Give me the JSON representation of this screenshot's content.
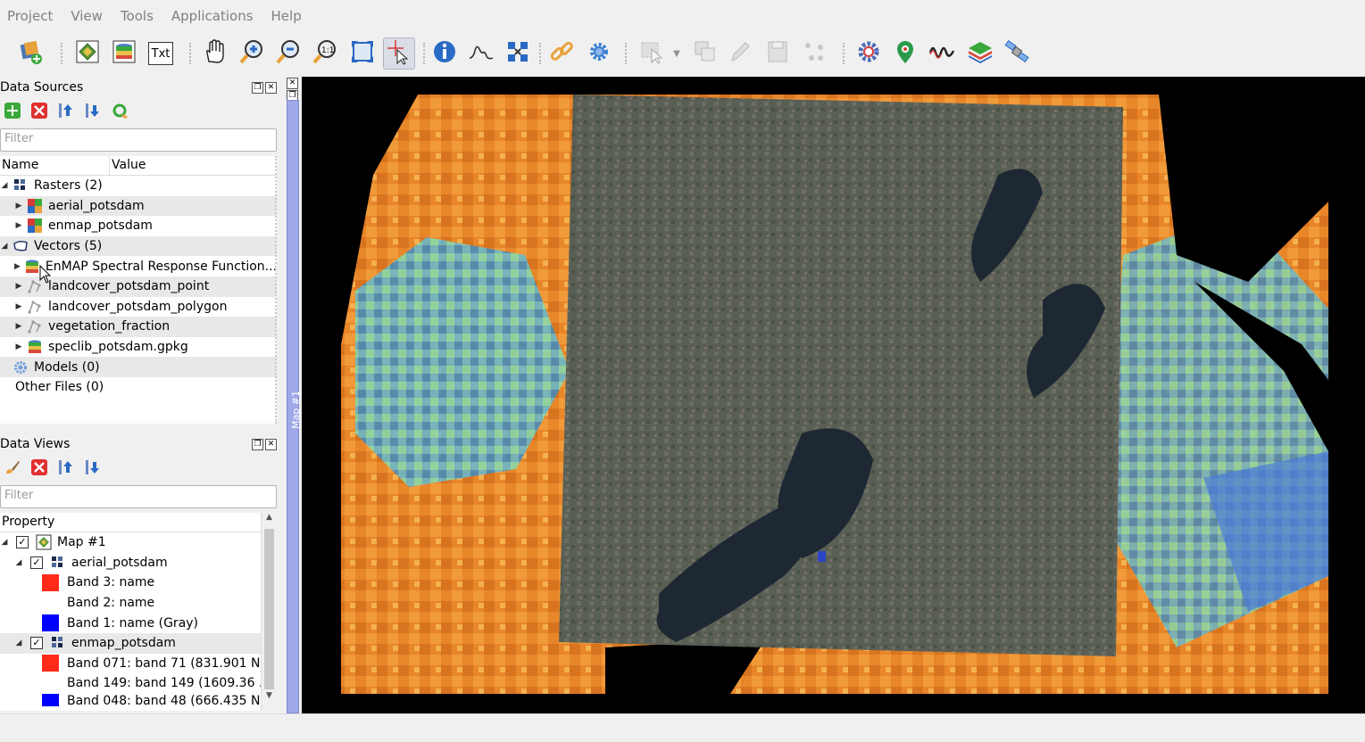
{
  "menu": [
    "Project",
    "View",
    "Tools",
    "Applications",
    "Help"
  ],
  "toolbar": {
    "txt_label": "Txt"
  },
  "data_sources": {
    "title": "Data Sources",
    "filter_placeholder": "Filter",
    "col_name": "Name",
    "col_value": "Value",
    "rasters_label": "Rasters (2)",
    "rasters": [
      "aerial_potsdam",
      "enmap_potsdam"
    ],
    "vectors_label": "Vectors (5)",
    "vectors": [
      "EnMAP Spectral Response Function...",
      "landcover_potsdam_point",
      "landcover_potsdam_polygon",
      "vegetation_fraction",
      "speclib_potsdam.gpkg"
    ],
    "models_label": "Models (0)",
    "other_label": "Other Files (0)"
  },
  "data_views": {
    "title": "Data Views",
    "filter_placeholder": "Filter",
    "col_property": "Property",
    "map_label": "Map #1",
    "layer1": "aerial_potsdam",
    "layer1_bands": [
      "Band 3: name",
      "Band 2: name",
      "Band 1: name (Gray)"
    ],
    "layer2": "enmap_potsdam",
    "layer2_bands": [
      "Band 071: band 71 (831.901 N...",
      "Band 149: band 149 (1609.36 ...",
      "Band 048: band 48 (666.435 N..."
    ]
  },
  "map_dock": {
    "tab_label": "Map #1"
  },
  "colors": {
    "red_band": "#ff2a1a",
    "blue_band": "#0000ff",
    "accent": "#9fa8e8"
  }
}
